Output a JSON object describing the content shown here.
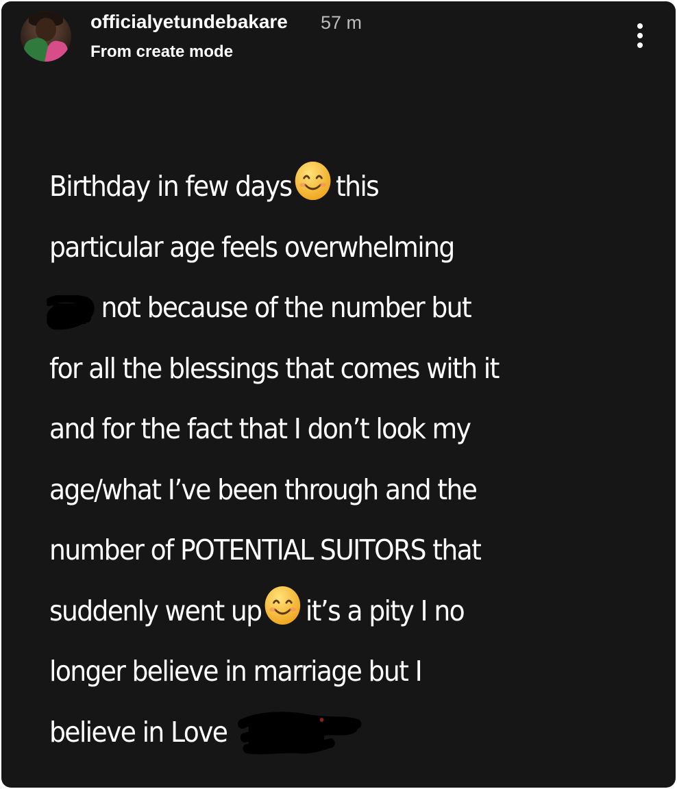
{
  "post": {
    "username": "officialyetundebakare",
    "time_ago": "57 m",
    "subtitle": "From create mode"
  },
  "icons": {
    "avatar": "profile-avatar",
    "more": "more-options-vertical-dots-icon",
    "emoji": "smiling-face-with-smiling-eyes-emoji",
    "redaction": "black-scribble-redaction"
  },
  "story": {
    "line1_a": "Birthday in few days",
    "line1_b": "this",
    "line2": "particular age feels overwhelming",
    "line3": "not because of the number but",
    "line4": "for all the blessings that comes with it",
    "line5": "and for the fact that I don’t look my",
    "line6": "age/what I’ve been through and the",
    "line7": "number of POTENTIAL SUITORS that",
    "line8_a": "suddenly went up",
    "line8_b": "it’s a pity I no",
    "line9": "longer believe in marriage but I",
    "line10": "believe in Love"
  },
  "colors": {
    "background": "#161616",
    "text": "#ffffff",
    "timestamp": "#bdbdbd",
    "emoji_face": "#f7c23a"
  }
}
